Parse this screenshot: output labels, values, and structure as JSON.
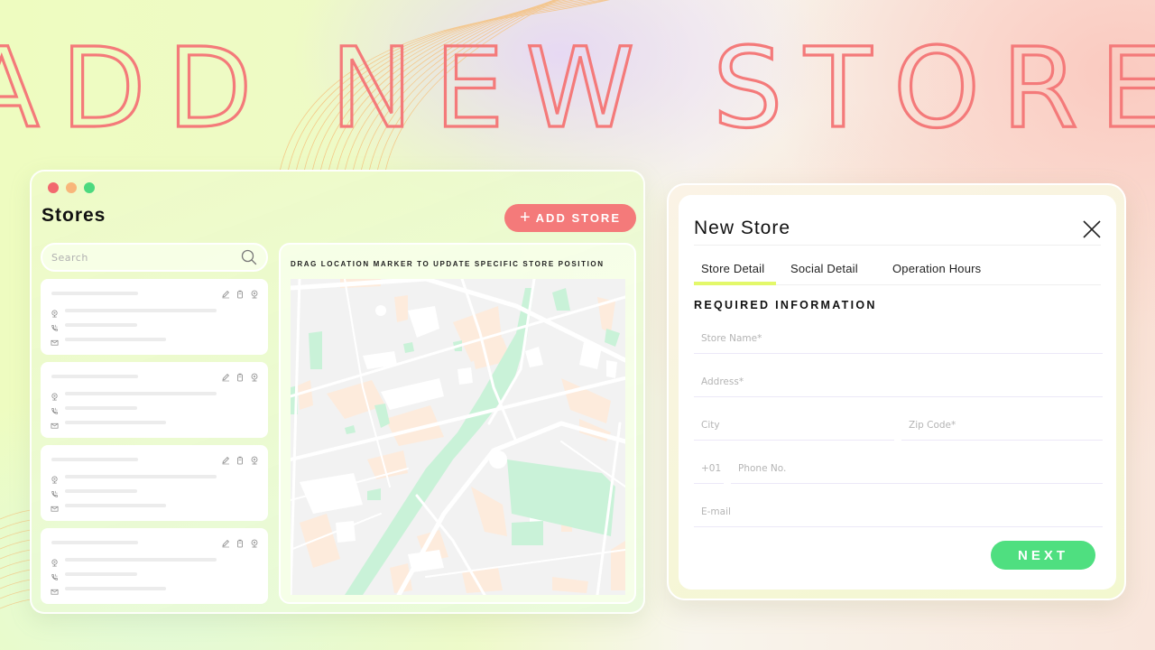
{
  "headline": "ADD NEW STORE",
  "colors": {
    "accent_red": "#f47a7a",
    "accent_green": "#4fdf80",
    "tab_underline": "#e3f86a",
    "dot_red": "#f2686e",
    "dot_orange": "#f8b67a",
    "dot_green": "#4cd97f"
  },
  "stores_window": {
    "title": "Stores",
    "add_button": {
      "icon": "plus-icon",
      "label": "ADD STORE"
    },
    "search": {
      "placeholder": "Search",
      "value": "",
      "icon": "search-icon"
    },
    "store_cards": [
      {
        "actions": [
          "edit-icon",
          "delete-icon",
          "location-icon"
        ],
        "rows": [
          "location-icon",
          "phone-icon",
          "mail-icon"
        ]
      },
      {
        "actions": [
          "edit-icon",
          "delete-icon",
          "location-icon"
        ],
        "rows": [
          "location-icon",
          "phone-icon",
          "mail-icon"
        ]
      },
      {
        "actions": [
          "edit-icon",
          "delete-icon",
          "location-icon"
        ],
        "rows": [
          "location-icon",
          "phone-icon",
          "mail-icon"
        ]
      },
      {
        "actions": [
          "edit-icon",
          "delete-icon",
          "location-icon"
        ],
        "rows": [
          "location-icon",
          "phone-icon",
          "mail-icon"
        ]
      }
    ],
    "map_hint": "DRAG LOCATION MARKER TO UPDATE SPECIFIC STORE POSITION"
  },
  "new_store_modal": {
    "title": "New Store",
    "close_icon": "close-icon",
    "tabs": [
      {
        "label": "Store Detail",
        "active": true
      },
      {
        "label": "Social Detail",
        "active": false
      },
      {
        "label": "Operation Hours",
        "active": false
      }
    ],
    "section_title": "REQUIRED INFORMATION",
    "fields": {
      "store_name": {
        "placeholder": "Store Name*",
        "value": ""
      },
      "address": {
        "placeholder": "Address*",
        "value": ""
      },
      "city": {
        "placeholder": "City",
        "value": ""
      },
      "zip_code": {
        "placeholder": "Zip Code*",
        "value": ""
      },
      "country_code": {
        "placeholder": "+01",
        "value": ""
      },
      "phone": {
        "placeholder": "Phone No.",
        "value": ""
      },
      "email": {
        "placeholder": "E-mail",
        "value": ""
      }
    },
    "next_button": "NEXT"
  }
}
